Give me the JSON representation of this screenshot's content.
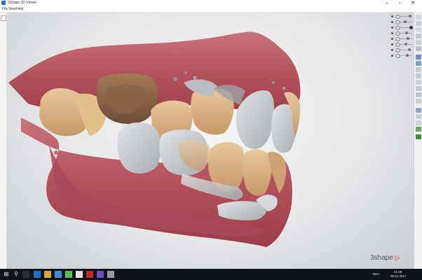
{
  "window": {
    "title": "3Shape 3D Viewer",
    "minimize": "–",
    "maximize": "▫",
    "close": "✕"
  },
  "menu": {
    "file": "File",
    "view": "View",
    "help": "Help"
  },
  "logo": {
    "text": "3shape",
    "mark": "▷"
  },
  "colors": {
    "close_accent": "#c0272d",
    "gum": "#b85a63",
    "tooth": "#d8b48a",
    "scan_gray": "#c9ccce",
    "taskbar": "#101418"
  },
  "layers": [
    {
      "icon": "eye-icon",
      "remove": "✕"
    },
    {
      "icon": "eye-icon",
      "remove": "✕"
    },
    {
      "icon": "eye-icon",
      "remove": "✕"
    },
    {
      "icon": "eye-icon",
      "remove": "✕"
    },
    {
      "icon": "eye-icon",
      "remove": "✕"
    },
    {
      "icon": "eye-icon",
      "remove": "✕"
    },
    {
      "icon": "eye-icon",
      "remove": "✕"
    },
    {
      "icon": "eye-icon",
      "remove": "✕"
    }
  ],
  "taskbar": {
    "start": "⊞",
    "search": "⚲",
    "clock_time": "21:09",
    "clock_date": "06.01.2017",
    "lang": "DEU"
  }
}
